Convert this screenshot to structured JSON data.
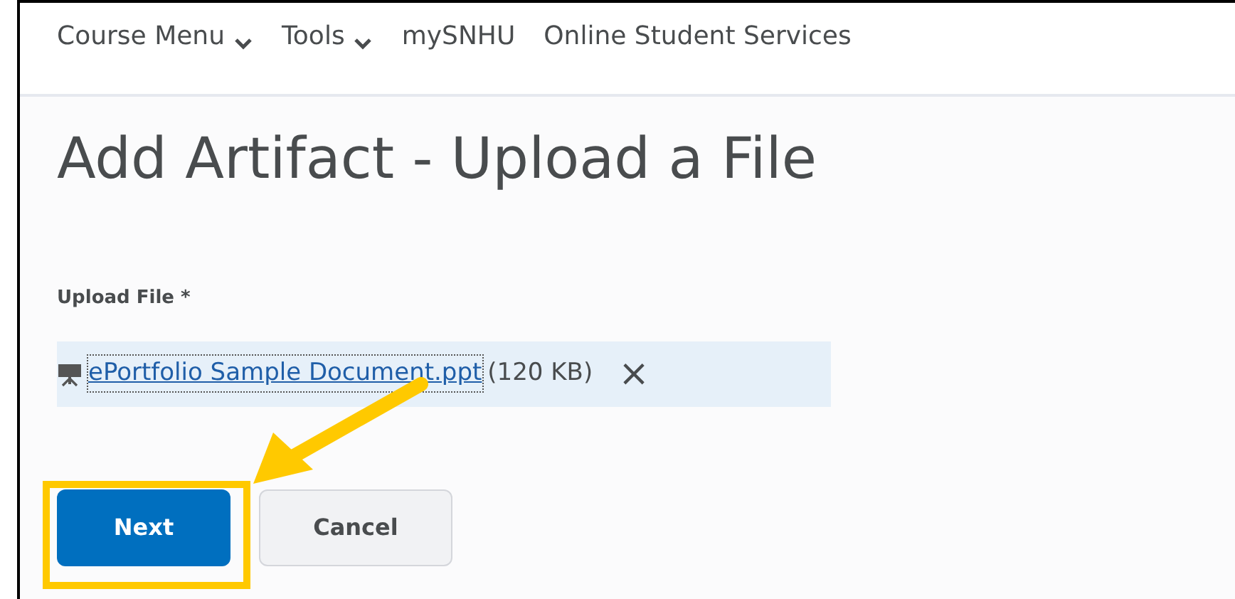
{
  "nav": [
    {
      "label": "Course Menu",
      "has_dropdown": true
    },
    {
      "label": "Tools",
      "has_dropdown": true
    },
    {
      "label": "mySNHU",
      "has_dropdown": false
    },
    {
      "label": "Online Student Services",
      "has_dropdown": false
    }
  ],
  "page_title": "Add Artifact - Upload a File",
  "upload": {
    "label": "Upload File *",
    "file": {
      "name": "ePortfolio Sample Document.ppt",
      "size": "(120 KB)",
      "remove": "×"
    }
  },
  "buttons": [
    {
      "label": "Next",
      "kind": "primary"
    },
    {
      "label": "Cancel",
      "kind": "secondary"
    }
  ]
}
